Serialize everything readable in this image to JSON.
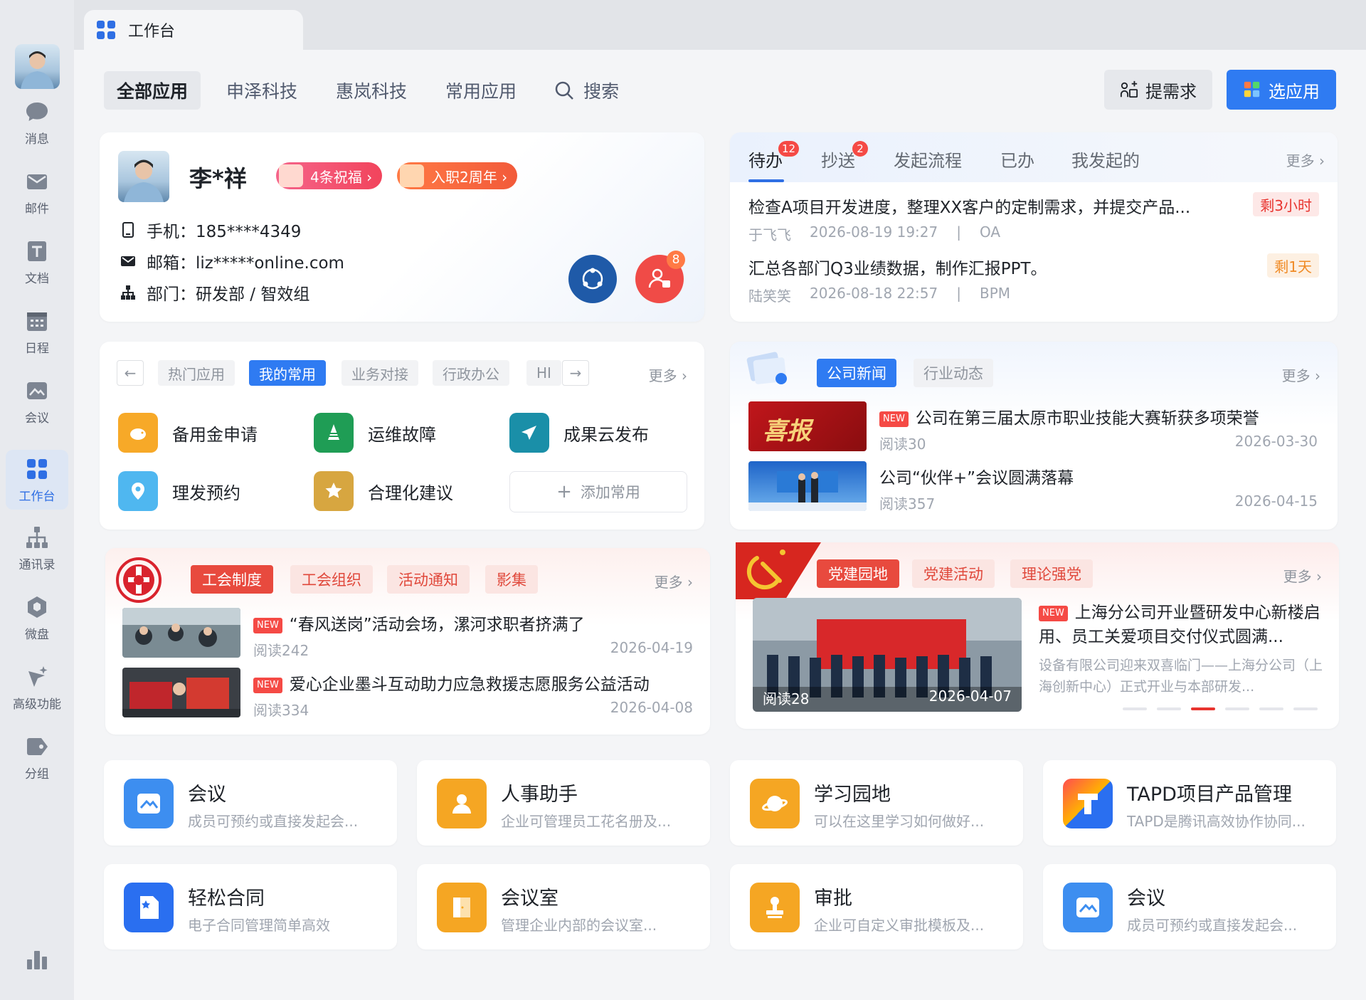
{
  "window": {
    "dot_colors": [
      "#fe5f57",
      "#febc2e",
      "#28c840"
    ]
  },
  "sidebar": {
    "items": [
      {
        "label": "消息",
        "icon": "chat-bubble-icon"
      },
      {
        "label": "邮件",
        "icon": "mail-icon"
      },
      {
        "label": "文档",
        "icon": "document-icon"
      },
      {
        "label": "日程",
        "icon": "calendar-icon"
      },
      {
        "label": "会议",
        "icon": "meeting-icon"
      },
      {
        "label": "工作台",
        "icon": "workspace-grid-icon"
      },
      {
        "label": "通讯录",
        "icon": "org-chart-icon"
      },
      {
        "label": "微盘",
        "icon": "cloud-disk-icon"
      },
      {
        "label": "高级功能",
        "icon": "sparkle-icon"
      },
      {
        "label": "分组",
        "icon": "tag-icon"
      }
    ],
    "active": "工作台"
  },
  "tab": {
    "title": "工作台"
  },
  "topnav": {
    "tabs": [
      "全部应用",
      "申泽科技",
      "惠岚科技",
      "常用应用"
    ],
    "search_label": "搜索",
    "request_btn": "提需求",
    "select_btn": "选应用"
  },
  "profile": {
    "name": "李*祥",
    "badge_wishes": "4条祝福 ›",
    "badge_anniversary": "入职2周年 ›",
    "phone_label": "手机：",
    "phone": "185****4349",
    "email_label": "邮箱：",
    "email": "liz*****online.com",
    "dept_label": "部门：",
    "dept": "研发部 / 智效组",
    "contact_badge": "8"
  },
  "todo": {
    "tabs": [
      {
        "label": "待办",
        "count": "12"
      },
      {
        "label": "抄送",
        "count": "2"
      },
      {
        "label": "发起流程"
      },
      {
        "label": "已办"
      },
      {
        "label": "我发起的"
      }
    ],
    "more": "更多 ›",
    "items": [
      {
        "title": "检查A项目开发进度，整理XX客户的定制需求，并提交产品...",
        "person": "于飞飞",
        "time": "2026-08-19 19:27",
        "sep": "|",
        "system": "OA",
        "tag": "剩3小时"
      },
      {
        "title": "汇总各部门Q3业绩数据，制作汇报PPT。",
        "person": "陆笑笑",
        "time": "2026-08-18 22:57",
        "sep": "|",
        "system": "BPM",
        "tag": "剩1天"
      }
    ]
  },
  "apps": {
    "chips": [
      "热门应用",
      "我的常用",
      "业务对接",
      "行政办公",
      "HI"
    ],
    "prev": "←",
    "next": "→",
    "more": "更多 ›",
    "items": [
      {
        "label": "备用金申请",
        "color": "#f7a928"
      },
      {
        "label": "运维故障",
        "color": "#1f9d55"
      },
      {
        "label": "成果云发布",
        "color": "#1a8fa8"
      },
      {
        "label": "理发预约",
        "color": "#4fb7f0"
      },
      {
        "label": "合理化建议",
        "color": "#d7a640"
      }
    ],
    "add_label": "添加常用"
  },
  "news": {
    "chips": [
      "公司新闻",
      "行业动态"
    ],
    "more": "更多 ›",
    "new_tag": "NEW",
    "items": [
      {
        "title": "公司在第三届太原市职业技能大赛斩获多项荣誉",
        "reads": "阅读30",
        "date": "2026-03-30",
        "new": true
      },
      {
        "title": "公司“伙伴+”会议圆满落幕",
        "reads": "阅读357",
        "date": "2026-04-15",
        "new": false
      }
    ],
    "thumb_text": "喜报"
  },
  "union": {
    "chips": [
      "工会制度",
      "工会组织",
      "活动通知",
      "影集"
    ],
    "more": "更多 ›",
    "new_tag": "NEW",
    "items": [
      {
        "title": "“春风送岗”活动会场，漯河求职者挤满了",
        "reads": "阅读242",
        "date": "2026-04-19"
      },
      {
        "title": "爱心企业墨斗互动助力应急救援志愿服务公益活动",
        "reads": "阅读334",
        "date": "2026-04-08"
      }
    ]
  },
  "party": {
    "chips": [
      "党建园地",
      "党建活动",
      "理论强党"
    ],
    "more": "更多 ›",
    "new_tag": "NEW",
    "title": "上海分公司开业暨研发中心新楼启用、员工关爱项目交付仪式圆满...",
    "desc": "设备有限公司迎来双喜临门——上海分公司（上海创新中心）正式开业与本部研发...",
    "reads": "阅读28",
    "date": "2026-04-07",
    "carousel_active_index": 2,
    "carousel_count": 6
  },
  "tiles": [
    {
      "name": "会议",
      "desc": "成员可预约或直接发起会...",
      "color": "#3d8ef0"
    },
    {
      "name": "人事助手",
      "desc": "企业可管理员工花名册及...",
      "color": "#f5a623"
    },
    {
      "name": "学习园地",
      "desc": "可以在这里学习如何做好...",
      "color": "#f5a623"
    },
    {
      "name": "TAPD项目产品管理",
      "desc": "TAPD是腾讯高效协作协同...",
      "color": "#2a6ff0"
    },
    {
      "name": "轻松合同",
      "desc": "电子合同管理简单高效",
      "color": "#2a6ff0"
    },
    {
      "name": "会议室",
      "desc": "管理企业内部的会议室...",
      "color": "#f5a623"
    },
    {
      "name": "审批",
      "desc": "企业可自定义审批模板及...",
      "color": "#f5a623"
    },
    {
      "name": "会议",
      "desc": "成员可预约或直接发起会...",
      "color": "#3d8ef0"
    }
  ]
}
